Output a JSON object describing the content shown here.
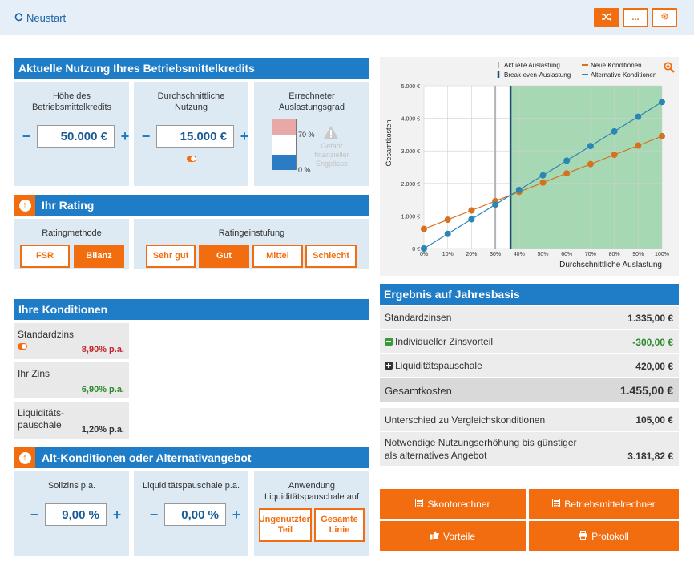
{
  "topbar": {
    "restart_label": "Neustart",
    "shuffle_icon": "shuffle-icon",
    "more_label": "...",
    "settings_icon": "gear-icon"
  },
  "kredit": {
    "title": "Aktuelle Nutzung Ihres Betriebsmittelkredits",
    "hoehe_label": "Höhe des Betriebsmittelkredits",
    "hoehe_value": "50.000 €",
    "nutzung_label": "Durchschnittliche Nutzung",
    "nutzung_value": "15.000 €",
    "auslastung_label": "Errechneter Auslastungsgrad",
    "gauge_70": "70 %",
    "gauge_0": "0 %",
    "gefahr_text": "Gefahr finanzieller Engpässe",
    "auslastung_level": 0.3
  },
  "rating": {
    "title": "Ihr Rating",
    "methode_label": "Ratingmethode",
    "methoden": [
      "FSR",
      "Bilanz"
    ],
    "methode_selected": "Bilanz",
    "einstufung_label": "Ratingeinstufung",
    "stufen": [
      "Sehr gut",
      "Gut",
      "Mittel",
      "Schlecht"
    ],
    "stufe_selected": "Gut"
  },
  "konditionen": {
    "title": "Ihre Konditionen",
    "standardzins_label": "Standardzins",
    "standardzins_value": "8,90% p.a.",
    "ihrzins_label": "Ihr Zins",
    "ihrzins_value": "6,90% p.a.",
    "liq_label_1": "Liquiditäts-",
    "liq_label_2": "pauschale",
    "liq_value": "1,20% p.a."
  },
  "alt": {
    "title": "Alt-Konditionen oder Alternativangebot",
    "sollzins_label": "Sollzins p.a.",
    "sollzins_value": "9,00 %",
    "liq_label": "Liquiditätspauschale p.a.",
    "liq_value": "0,00 %",
    "anwendung_label": "Anwendung Liquiditätspauschale auf",
    "opt1_line1": "Ungenutzten",
    "opt1_line2": "Teil",
    "opt2_line1": "Gesamte",
    "opt2_line2": "Linie"
  },
  "ergebnis": {
    "title": "Ergebnis auf Jahresbasis",
    "rows": [
      {
        "label": "Standardzinsen",
        "value": "1.335,00 €"
      },
      {
        "label": "Individueller Zinsvorteil",
        "value": "-300,00 €"
      },
      {
        "label": "Liquiditätspauschale",
        "value": "420,00 €"
      }
    ],
    "gesamt_label": "Gesamtkosten",
    "gesamt_value": "1.455,00 €",
    "unterschied_label": "Unterschied zu Vergleichskonditionen",
    "unterschied_value": "105,00 €",
    "notwendig_label_1": "Notwendige Nutzungserhöhung bis günstiger",
    "notwendig_label_2": "als alternatives Angebot",
    "notwendig_value": "3.181,82 €"
  },
  "buttons": {
    "skonto": "Skontorechner",
    "betriebsmittel": "Betriebsmittelrechner",
    "vorteile": "Vorteile",
    "protokoll": "Protokoll"
  },
  "colors": {
    "accent": "#f26d0f",
    "primary": "#1f7cc7",
    "neue": "#d6711f",
    "alternative": "#2a86b5",
    "breakeven_zone": "#a6d9b3",
    "positive": "#2c8a2c",
    "negative": "#c0262c"
  },
  "chart_data": {
    "type": "line",
    "xlabel": "Durchschnittliche Auslastung",
    "ylabel": "Gesamtkosten",
    "x": [
      0,
      10,
      20,
      30,
      40,
      50,
      60,
      70,
      80,
      90,
      100
    ],
    "x_ticks": [
      "0%",
      "10%",
      "20%",
      "30%",
      "40%",
      "50%",
      "60%",
      "70%",
      "80%",
      "90%",
      "100%"
    ],
    "y_ticks": [
      "0 €",
      "1.000 €",
      "2.000 €",
      "3.000 €",
      "4.000 €",
      "5.000 €"
    ],
    "ylim": [
      0,
      5000
    ],
    "xlim": [
      0,
      100
    ],
    "legend": [
      {
        "name": "Aktuelle Auslastung",
        "kind": "vline-light"
      },
      {
        "name": "Break-even-Auslastung",
        "kind": "vline-dark"
      },
      {
        "name": "Neue Konditionen",
        "kind": "line"
      },
      {
        "name": "Alternative Konditionen",
        "kind": "line"
      }
    ],
    "series": [
      {
        "name": "Neue Konditionen",
        "values": [
          600,
          885,
          1170,
          1455,
          1740,
          2025,
          2310,
          2595,
          2880,
          3165,
          3450
        ]
      },
      {
        "name": "Alternative Konditionen",
        "values": [
          0,
          450,
          900,
          1350,
          1800,
          2250,
          2700,
          3150,
          3600,
          4050,
          4500
        ]
      }
    ],
    "aktuelle_auslastung": 30,
    "break_even": 36.4,
    "zoom_icon": "zoom-icon"
  }
}
